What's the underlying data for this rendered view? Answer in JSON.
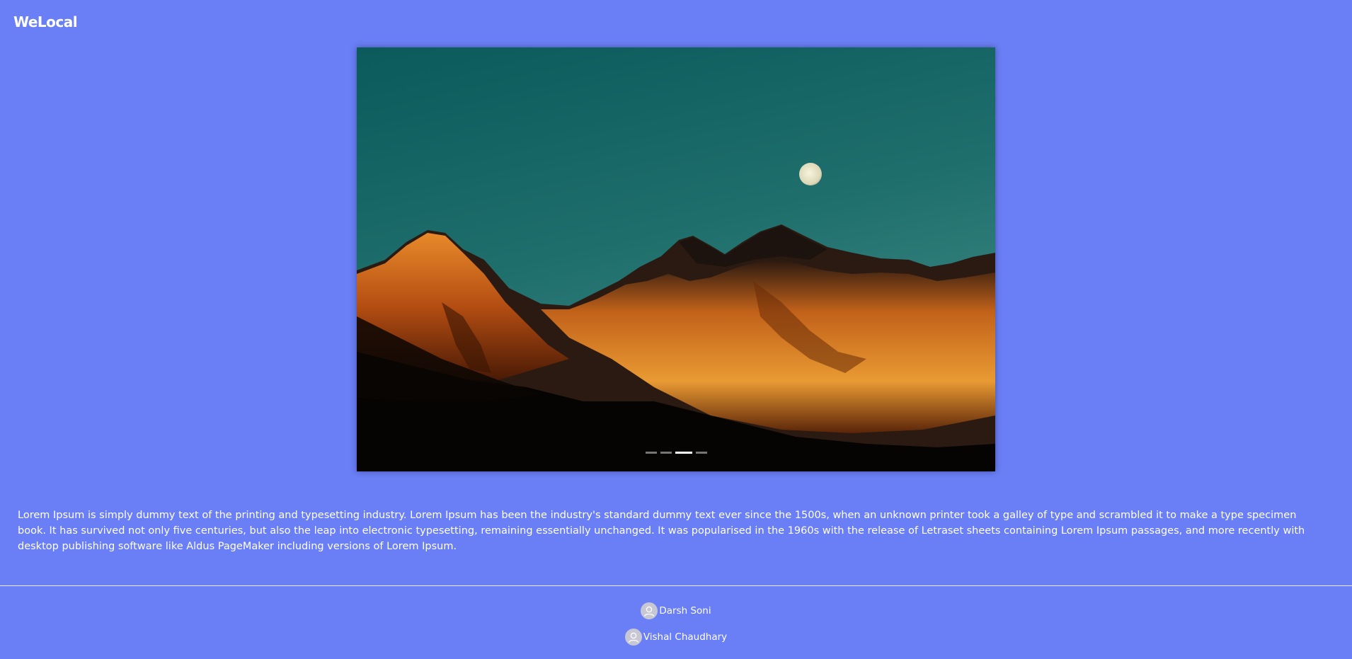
{
  "header": {
    "logo": "WeLocal"
  },
  "carousel": {
    "image_alt": "Mountain range at sunset with full moon",
    "slide_count": 4,
    "active_index": 2
  },
  "description": "Lorem Ipsum is simply dummy text of the printing and typesetting industry. Lorem Ipsum has been the industry's standard dummy text ever since the 1500s, when an unknown printer took a galley of type and scrambled it to make a type specimen book. It has survived not only five centuries, but also the leap into electronic typesetting, remaining essentially unchanged. It was popularised in the 1960s with the release of Letraset sheets containing Lorem Ipsum passages, and more recently with desktop publishing software like Aldus PageMaker including versions of Lorem Ipsum.",
  "footer": {
    "contributors": [
      {
        "name": "Darsh Soni",
        "icon": "user-avatar-icon"
      },
      {
        "name": "Vishal Chaudhary",
        "icon": "user-avatar-icon"
      }
    ]
  },
  "colors": {
    "background": "#6a7ef5",
    "text": "#ffffff"
  }
}
